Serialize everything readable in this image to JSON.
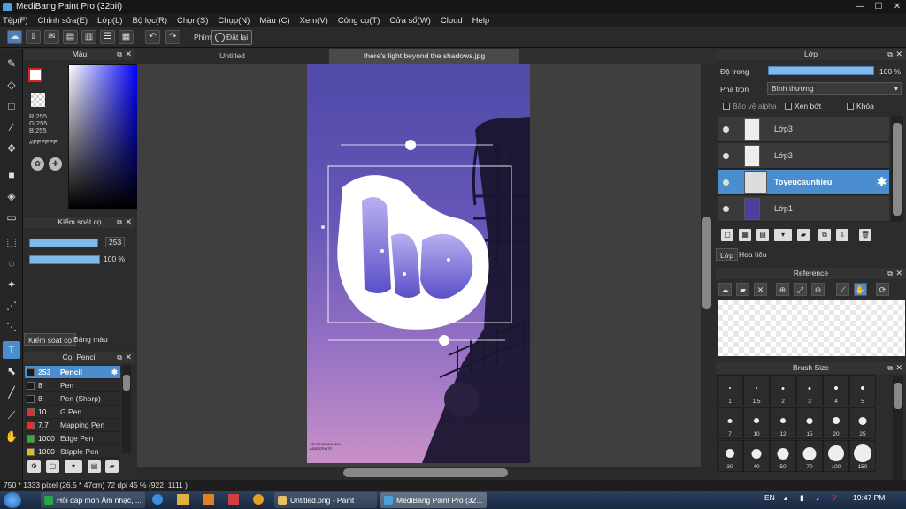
{
  "window": {
    "title": "MediBang Paint Pro (32bit)",
    "min": "—",
    "max": "☐",
    "close": "✕"
  },
  "menu": [
    "Tệp(F)",
    "Chỉnh sửa(E)",
    "Lớp(L)",
    "Bộ lọc(R)",
    "Chọn(S)",
    "Chụp(N)",
    "Màu (C)",
    "Xem(V)",
    "Công cụ(T)",
    "Cửa sổ(W)",
    "Cloud",
    "Help"
  ],
  "toolbar": {
    "phim": "Phím",
    "reset": "Đặt lại"
  },
  "color_panel": {
    "title": "Màu",
    "r": "R:255",
    "g": "G:255",
    "b": "B:255",
    "hex": "#FFFFFF"
  },
  "brush_control": {
    "title": "Kiểm soát cọ",
    "size_value": "253",
    "opacity_value": "100 %",
    "size_fraction": 0.97,
    "opacity_fraction": 1.0,
    "tabs": [
      "Kiểm soát cọ",
      "Bảng màu"
    ]
  },
  "brush_list": {
    "title": "Cọ: Pencil",
    "items": [
      {
        "size": "253",
        "name": "Pencil",
        "color": "#1a1a1a"
      },
      {
        "size": "8",
        "name": "Pen",
        "color": "#1a1a1a"
      },
      {
        "size": "8",
        "name": "Pen (Sharp)",
        "color": "#1a1a1a"
      },
      {
        "size": "10",
        "name": "G Pen",
        "color": "#e03030"
      },
      {
        "size": "7.7",
        "name": "Mapping Pen",
        "color": "#e03030"
      },
      {
        "size": "1000",
        "name": "Edge Pen",
        "color": "#30b030"
      },
      {
        "size": "1000",
        "name": "Stipple Pen",
        "color": "#e0c020"
      }
    ]
  },
  "doc_tabs": [
    "Untitled",
    "there's light beyond the shadows.jpg"
  ],
  "artwork": {
    "watermark": "TOYEUCAUNHIEU ADEDEPWTF"
  },
  "layer_panel": {
    "title": "Lớp",
    "opacity_label": "Độ trong",
    "opacity_value": "100 %",
    "opacity_fraction": 1.0,
    "blend_label": "Pha trộn",
    "blend_value": "Bình thường",
    "checks": [
      "Bảo vệ alpha",
      "Xén bớt",
      "Khóa"
    ],
    "layers": [
      "Lớp3",
      "Lớp3",
      "Toyeucaunhieu",
      "Lớp1"
    ],
    "tabs": [
      "Lớp",
      "Hoa tiêu"
    ]
  },
  "reference": {
    "title": "Reference"
  },
  "brush_size": {
    "title": "Brush Size",
    "sizes": [
      "1",
      "1.5",
      "2",
      "3",
      "4",
      "5",
      "7",
      "10",
      "12",
      "15",
      "20",
      "25",
      "30",
      "40",
      "50",
      "70",
      "100",
      "150"
    ]
  },
  "status": "750 * 1333 pixel  (26.5 * 47cm)  72 dpi  45 %  (922, 1111 )",
  "taskbar": {
    "tasks": [
      "Hỏi đáp môn Âm nhạc, ...",
      "Untitled.png - Paint",
      "MediBang Paint Pro (32..."
    ],
    "lang": "EN",
    "time": "19:47 PM"
  }
}
